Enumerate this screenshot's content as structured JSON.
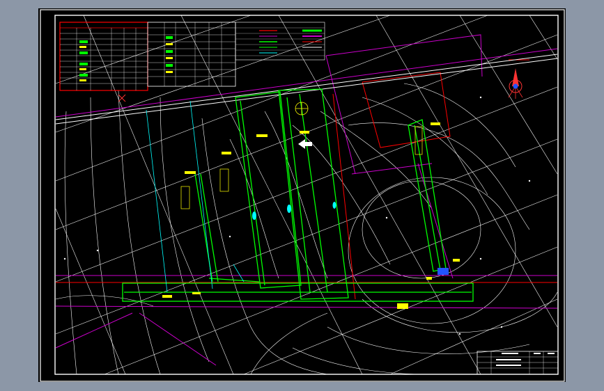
{
  "colors": {
    "background_outer": "#8c97a7",
    "drawing_background": "#000000",
    "frame": "#ffffff",
    "contour": "#ffffff",
    "grid": "#ffffff",
    "boundary": "#cc00cc",
    "road": "#00ff00",
    "pipe": "#00ffff",
    "label": "#ffff00",
    "table_red": "#ff0000",
    "north_arrow": "#ff3333"
  },
  "icons": {
    "north_arrow": "north-arrow-icon",
    "compass_circle": "compass-circle-icon",
    "direction_arrow": "direction-arrow-icon"
  }
}
